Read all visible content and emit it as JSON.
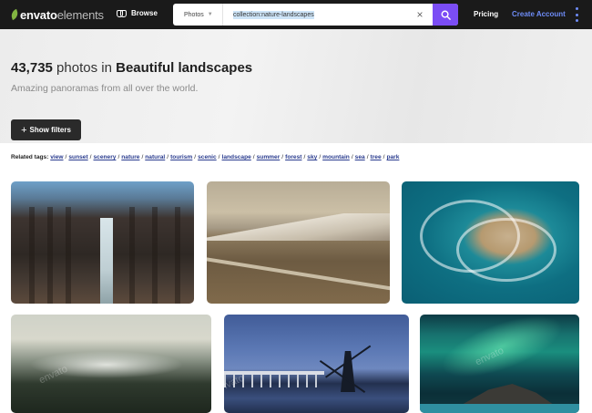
{
  "header": {
    "logo": {
      "brand": "envato",
      "product": "elements"
    },
    "browse_label": "Browse",
    "search": {
      "category": "Photos",
      "query": "collection:nature-landscapes"
    },
    "pricing_label": "Pricing",
    "create_account_label": "Create Account"
  },
  "hero": {
    "count": "43,735",
    "middle_text": " photos in ",
    "collection_name": "Beautiful landscapes",
    "subtitle": "Amazing panoramas from all over the world.",
    "show_filters_label": "Show filters"
  },
  "related_tags": {
    "label": "Related tags:",
    "tags": [
      "view",
      "sunset",
      "scenery",
      "nature",
      "natural",
      "tourism",
      "scenic",
      "landscape",
      "summer",
      "forest",
      "sky",
      "mountain",
      "sea",
      "tree",
      "park"
    ]
  },
  "watermark": "envato",
  "colors": {
    "header_bg": "#1a1a1a",
    "search_button": "#7b4df5",
    "accent_link": "#6e8cf7",
    "logo_leaf": "#82b541",
    "tag_link": "#2a3c8f"
  }
}
